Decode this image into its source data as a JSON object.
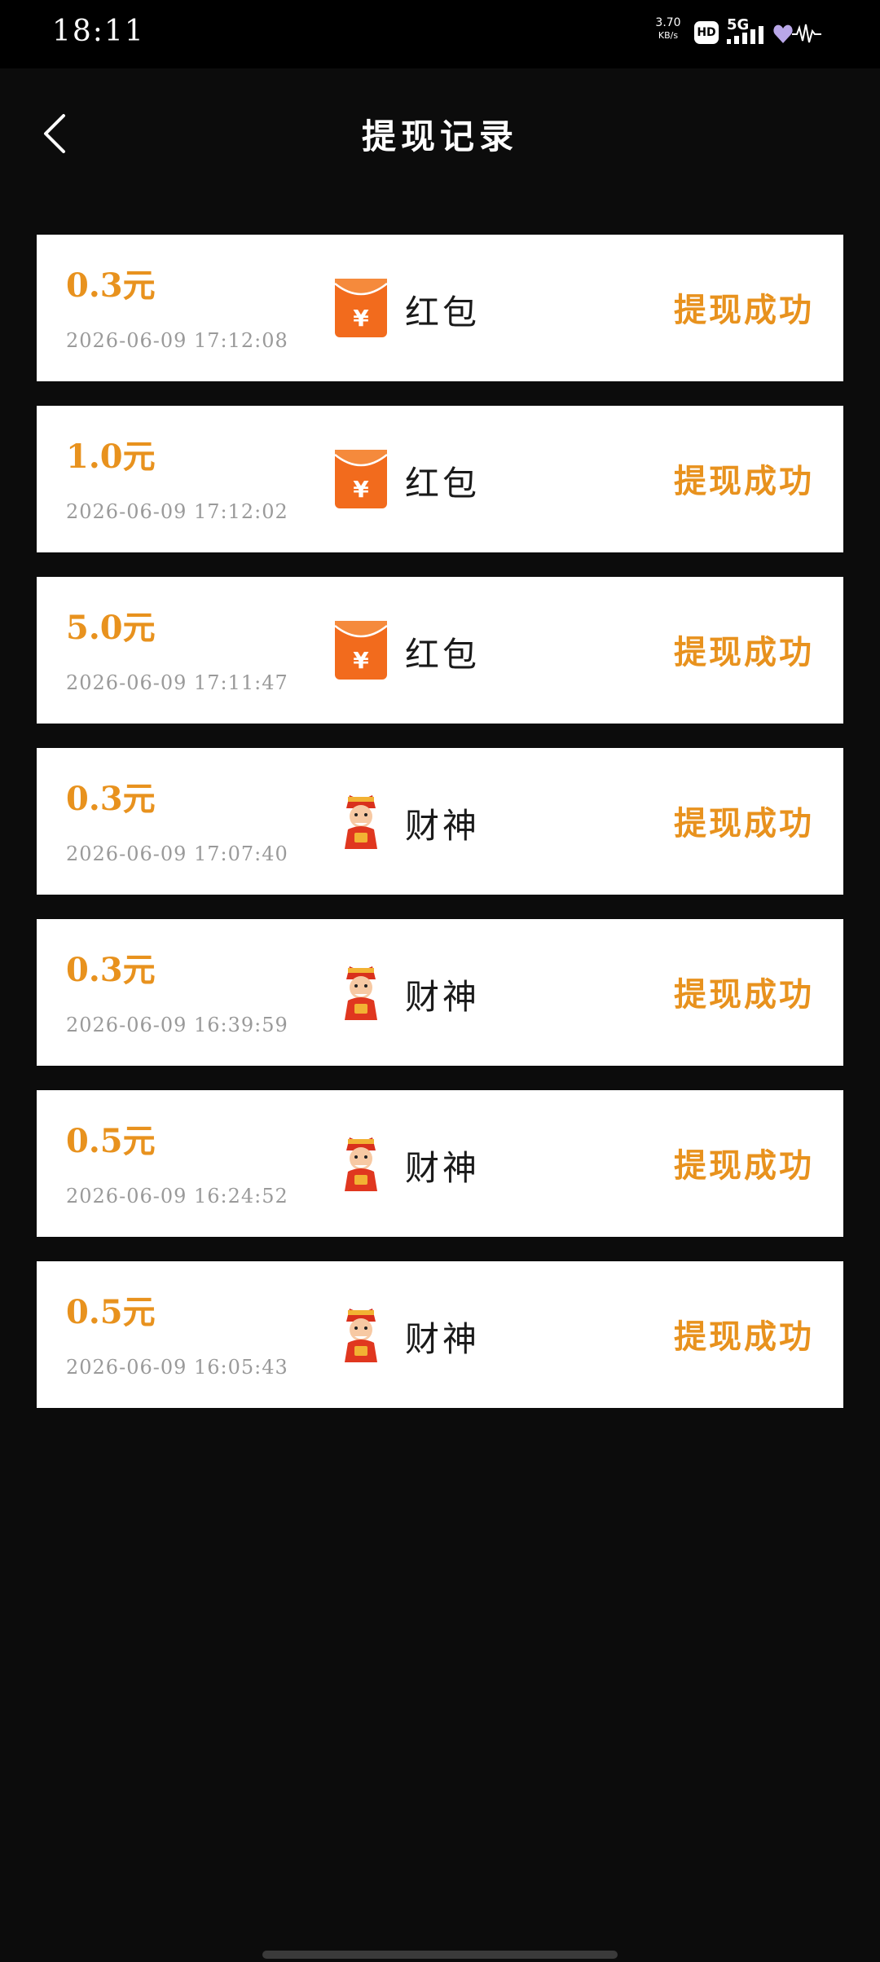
{
  "status_bar": {
    "time": "18:11",
    "net_speed_value": "3.70",
    "net_speed_unit": "KB/s",
    "hd_label": "HD",
    "network_label": "5G"
  },
  "header": {
    "title": "提现记录",
    "back_icon": "chevron-left-icon"
  },
  "colors": {
    "accent": "#e8921e",
    "card_bg": "#ffffff",
    "page_bg": "#0c0c0c",
    "timestamp": "#9a9a9a"
  },
  "records": [
    {
      "amount": "0.3元",
      "time": "2026-06-09 17:12:08",
      "type": "红包",
      "icon": "red-envelope-icon",
      "status": "提现成功"
    },
    {
      "amount": "1.0元",
      "time": "2026-06-09 17:12:02",
      "type": "红包",
      "icon": "red-envelope-icon",
      "status": "提现成功"
    },
    {
      "amount": "5.0元",
      "time": "2026-06-09 17:11:47",
      "type": "红包",
      "icon": "red-envelope-icon",
      "status": "提现成功"
    },
    {
      "amount": "0.3元",
      "time": "2026-06-09 17:07:40",
      "type": "财神",
      "icon": "god-of-wealth-icon",
      "status": "提现成功"
    },
    {
      "amount": "0.3元",
      "time": "2026-06-09 16:39:59",
      "type": "财神",
      "icon": "god-of-wealth-icon",
      "status": "提现成功"
    },
    {
      "amount": "0.5元",
      "time": "2026-06-09 16:24:52",
      "type": "财神",
      "icon": "god-of-wealth-icon",
      "status": "提现成功"
    },
    {
      "amount": "0.5元",
      "time": "2026-06-09 16:05:43",
      "type": "财神",
      "icon": "god-of-wealth-icon",
      "status": "提现成功"
    }
  ]
}
